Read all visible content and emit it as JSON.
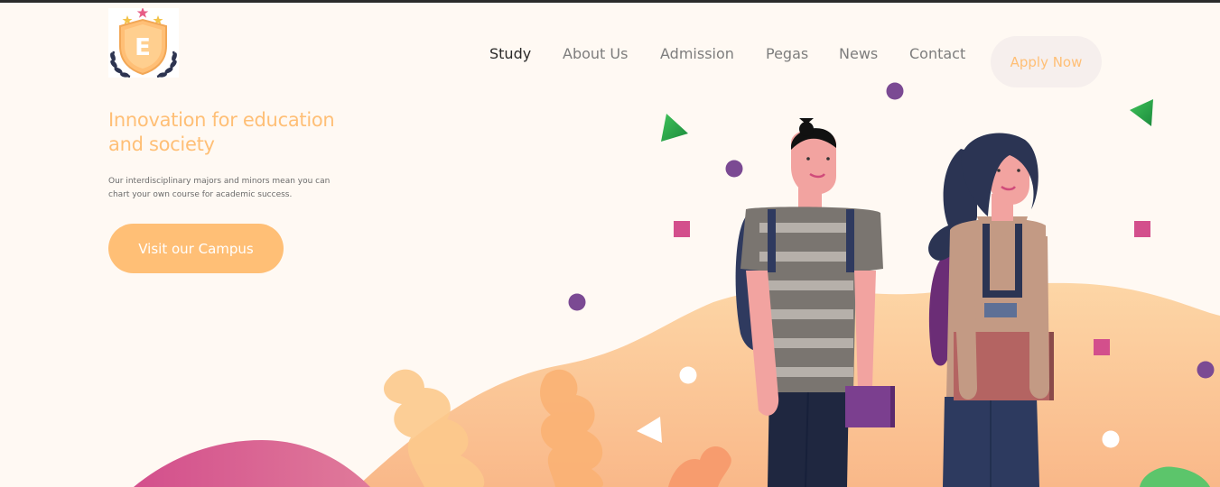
{
  "nav": {
    "items": [
      {
        "label": "Study",
        "active": true
      },
      {
        "label": "About Us",
        "active": false
      },
      {
        "label": "Admission",
        "active": false
      },
      {
        "label": "Pegas",
        "active": false
      },
      {
        "label": "News",
        "active": false
      },
      {
        "label": "Contact",
        "active": false
      }
    ],
    "apply_label": "Apply Now"
  },
  "logo": {
    "letter": "E"
  },
  "hero": {
    "title_line1": "Innovation for education",
    "title_line2": "and society",
    "text_line1": "Our interdisciplinary majors and minors mean you can",
    "text_line2": "chart your own course for academic success.",
    "button_label": "Visit our Campus"
  },
  "colors": {
    "background": "#fff9f3",
    "accent": "#ffbf76",
    "nav_active": "#2a2a2a",
    "nav_text": "#7d7d7d",
    "apply_bg": "#f6efed"
  }
}
